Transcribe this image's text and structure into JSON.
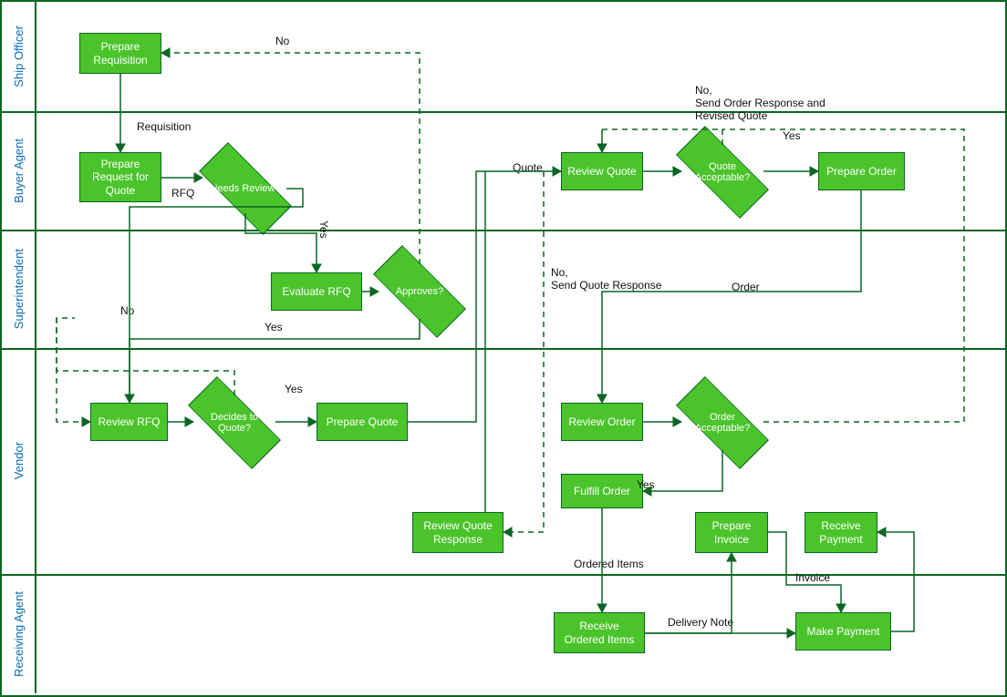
{
  "lanes": {
    "l1": "Ship Officer",
    "l2": "Buyer Agent",
    "l3": "Superintendent",
    "l4": "Vendor",
    "l5": "Receiving Agent"
  },
  "nodes": {
    "prepReq": "Prepare Requisition",
    "prepRFQ": "Prepare Request for Quote",
    "needsReview": "Needs Review?",
    "evalRFQ": "Evaluate RFQ",
    "approves": "Approves?",
    "reviewRFQ": "Review RFQ",
    "decidesQuote": "Decides to Quote?",
    "prepQuote": "Prepare Quote",
    "reviewQuote": "Review Quote",
    "quoteAccept": "Quote Acceptable?",
    "prepOrder": "Prepare Order",
    "reviewOrder": "Review Order",
    "orderAccept": "Order Acceptable?",
    "fulfillOrder": "Fulfill Order",
    "reviewQR": "Review Quote Response",
    "prepInvoice": "Prepare Invoice",
    "recvPayment": "Receive Payment",
    "recvItems": "Receive Ordered Items",
    "makePay": "Make Payment"
  },
  "labels": {
    "requisition": "Requisition",
    "rfq": "RFQ",
    "yes1": "Yes",
    "no1": "No",
    "yes2": "Yes",
    "no2": "No",
    "yes3": "Yes",
    "sendQR": "No,\nSend Quote Response",
    "quote": "Quote",
    "yes4": "Yes",
    "sendOR": "No,\nSend Order Response and\nRevised Quote",
    "order": "Order",
    "yes5": "Yes",
    "orderedItems": "Ordered Items",
    "deliveryNote": "Delivery Note",
    "invoice": "Invoice"
  },
  "chart_data": {
    "type": "flowchart-swimlane",
    "lanes": [
      "Ship Officer",
      "Buyer Agent",
      "Superintendent",
      "Vendor",
      "Receiving Agent"
    ],
    "nodes": [
      {
        "id": "prepReq",
        "lane": "Ship Officer",
        "type": "process",
        "label": "Prepare Requisition"
      },
      {
        "id": "prepRFQ",
        "lane": "Buyer Agent",
        "type": "process",
        "label": "Prepare Request for Quote"
      },
      {
        "id": "needsReview",
        "lane": "Buyer Agent",
        "type": "decision",
        "label": "Needs Review?"
      },
      {
        "id": "evalRFQ",
        "lane": "Superintendent",
        "type": "process",
        "label": "Evaluate RFQ"
      },
      {
        "id": "approves",
        "lane": "Superintendent",
        "type": "decision",
        "label": "Approves?"
      },
      {
        "id": "reviewRFQ",
        "lane": "Vendor",
        "type": "process",
        "label": "Review RFQ"
      },
      {
        "id": "decidesQuote",
        "lane": "Vendor",
        "type": "decision",
        "label": "Decides to Quote?"
      },
      {
        "id": "prepQuote",
        "lane": "Vendor",
        "type": "process",
        "label": "Prepare Quote"
      },
      {
        "id": "reviewQuote",
        "lane": "Buyer Agent",
        "type": "process",
        "label": "Review Quote"
      },
      {
        "id": "quoteAccept",
        "lane": "Buyer Agent",
        "type": "decision",
        "label": "Quote Acceptable?"
      },
      {
        "id": "prepOrder",
        "lane": "Buyer Agent",
        "type": "process",
        "label": "Prepare Order"
      },
      {
        "id": "reviewOrder",
        "lane": "Vendor",
        "type": "process",
        "label": "Review Order"
      },
      {
        "id": "orderAccept",
        "lane": "Vendor",
        "type": "decision",
        "label": "Order Acceptable?"
      },
      {
        "id": "fulfillOrder",
        "lane": "Vendor",
        "type": "process",
        "label": "Fulfill Order"
      },
      {
        "id": "reviewQR",
        "lane": "Vendor",
        "type": "process",
        "label": "Review Quote Response"
      },
      {
        "id": "prepInvoice",
        "lane": "Vendor",
        "type": "process",
        "label": "Prepare Invoice"
      },
      {
        "id": "recvPayment",
        "lane": "Vendor",
        "type": "process",
        "label": "Receive Payment"
      },
      {
        "id": "recvItems",
        "lane": "Receiving Agent",
        "type": "process",
        "label": "Receive Ordered Items"
      },
      {
        "id": "makePay",
        "lane": "Receiving Agent",
        "type": "process",
        "label": "Make Payment"
      }
    ],
    "edges": [
      {
        "from": "prepReq",
        "to": "prepRFQ",
        "label": "Requisition"
      },
      {
        "from": "prepRFQ",
        "to": "needsReview",
        "label": "RFQ"
      },
      {
        "from": "needsReview",
        "to": "evalRFQ",
        "label": "Yes"
      },
      {
        "from": "needsReview",
        "to": "reviewRFQ",
        "label": ""
      },
      {
        "from": "evalRFQ",
        "to": "approves"
      },
      {
        "from": "approves",
        "to": "prepReq",
        "label": "No",
        "style": "dashed"
      },
      {
        "from": "approves",
        "to": "reviewRFQ",
        "label": "Yes"
      },
      {
        "from": "reviewRFQ",
        "to": "decidesQuote"
      },
      {
        "from": "decidesQuote",
        "to": "prepQuote",
        "label": "Yes"
      },
      {
        "from": "decidesQuote",
        "to": "reviewRFQ",
        "label": "No,\nSend Quote Response",
        "style": "dashed"
      },
      {
        "from": "prepQuote",
        "to": "reviewQuote",
        "label": "Quote"
      },
      {
        "from": "reviewQuote",
        "to": "quoteAccept"
      },
      {
        "from": "quoteAccept",
        "to": "prepOrder",
        "label": "Yes"
      },
      {
        "from": "quoteAccept",
        "to": "reviewQR",
        "label": "No,\nSend Order Response and Revised Quote",
        "style": "dashed"
      },
      {
        "from": "prepOrder",
        "to": "reviewOrder",
        "label": "Order"
      },
      {
        "from": "reviewOrder",
        "to": "orderAccept"
      },
      {
        "from": "orderAccept",
        "to": "fulfillOrder",
        "label": "Yes"
      },
      {
        "from": "orderAccept",
        "to": "reviewQuote",
        "style": "dashed"
      },
      {
        "from": "fulfillOrder",
        "to": "recvItems",
        "label": "Ordered Items"
      },
      {
        "from": "recvItems",
        "to": "prepInvoice",
        "label": "Delivery Note"
      },
      {
        "from": "recvItems",
        "to": "makePay"
      },
      {
        "from": "prepInvoice",
        "to": "makePay",
        "label": "Invoice"
      },
      {
        "from": "makePay",
        "to": "recvPayment"
      },
      {
        "from": "reviewQR",
        "to": "reviewQuote"
      }
    ]
  }
}
